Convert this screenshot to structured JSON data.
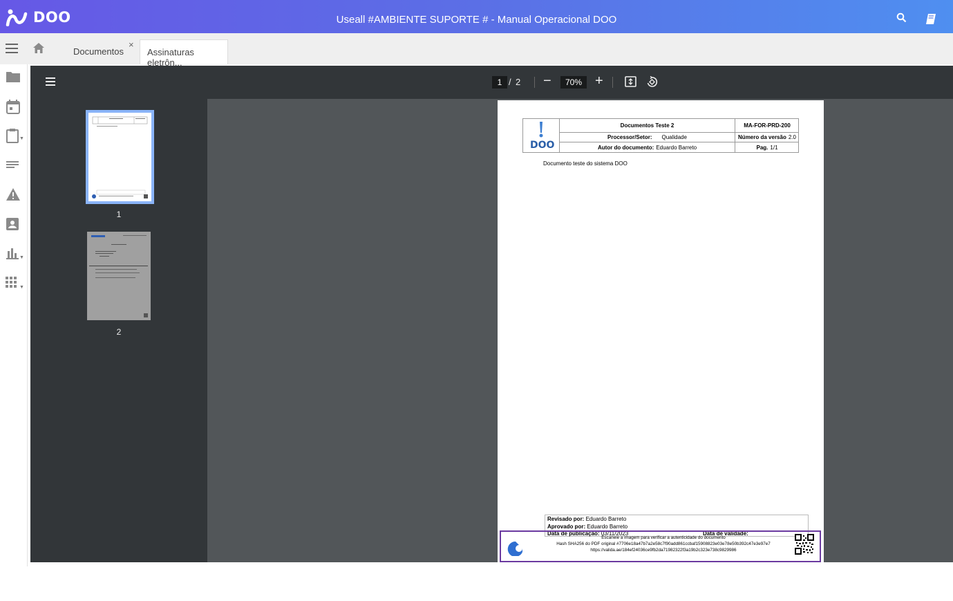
{
  "app": {
    "brand": "DOO",
    "title": "Useall #AMBIENTE SUPORTE # - Manual Operacional DOO"
  },
  "tabs": [
    {
      "label": "Documentos"
    },
    {
      "label": "Assinaturas eletrôn..."
    }
  ],
  "tab_close": "×",
  "viewer": {
    "current_page": "1",
    "separator": "/",
    "total_pages": "2",
    "zoom": "70%",
    "zoom_minus": "−",
    "zoom_plus": "+",
    "thumbnails": [
      "1",
      "2"
    ]
  },
  "document": {
    "logo_text": "DOO",
    "title": "Documentos Teste 2",
    "code": "MA-FOR-PRD-200",
    "process_label": "Processor/Setor:",
    "process_value": "Qualidade",
    "version_label": "Número da versão",
    "version_value": "2.0",
    "author_label": "Autor do documento:",
    "author_value": "Eduardo Barreto",
    "page_label": "Pag.",
    "page_value": "1/1",
    "body": "Documento teste do sistema DOO",
    "reviewed_label": "Revisado por:",
    "reviewed_value": "Eduardo Barreto",
    "approved_label": "Aprovado por:",
    "approved_value": "Eduardo Barreto",
    "published_label": "Data de publicação:",
    "published_value": "03/11/2023",
    "validity_label": "Data de validade:",
    "sig_line1": "Escaneie a imagem para verificar a autenticidade do documento",
    "sig_line2": "Hash SHA256 do PDF original #7706e18a47b7a2e58c7f90add861ccbaf15908823e03e78e50b392c47e3e97e7",
    "sig_line3": "https://valida.ae/184ef24036ce9fb2da71982322f3a19b2c323e738c9829986"
  },
  "colors": {
    "topbar_start": "#6658e6",
    "topbar_end": "#4f8ff0",
    "viewer_bg": "#525659",
    "toolbar_bg": "#323639",
    "thumb_highlight": "#8ab4f8",
    "signature_border": "#6b3aa0"
  },
  "icons": [
    "doo-logo-icon",
    "search-icon",
    "book-icon",
    "menu-icon",
    "home-icon",
    "folder-icon",
    "calendar-icon",
    "clipboard-icon",
    "list-icon",
    "warning-icon",
    "contact-icon",
    "chart-icon",
    "apps-icon",
    "fit-page-icon",
    "rotate-icon",
    "qr-code-icon"
  ]
}
